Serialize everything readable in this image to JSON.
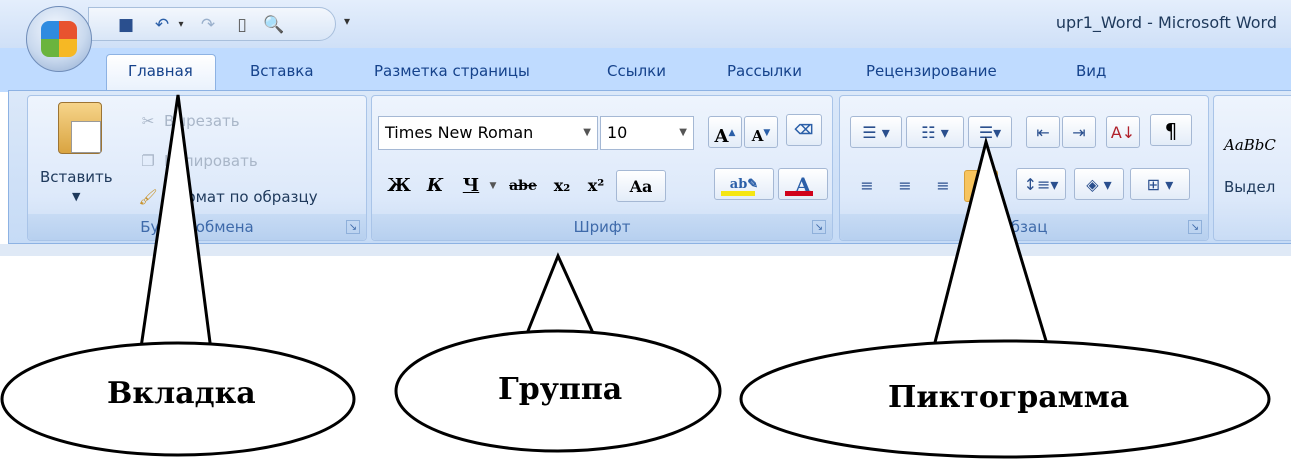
{
  "window": {
    "title": "upr1_Word - Microsoft Word"
  },
  "quick_access": {
    "icons": [
      "save-icon",
      "undo-icon",
      "redo-icon",
      "new-document-icon",
      "print-preview-icon"
    ],
    "customize_glyph": "▾"
  },
  "tabs": [
    {
      "label": "Главная",
      "active": true
    },
    {
      "label": "Вставка"
    },
    {
      "label": "Разметка страницы"
    },
    {
      "label": "Ссылки"
    },
    {
      "label": "Рассылки"
    },
    {
      "label": "Рецензирование"
    },
    {
      "label": "Вид"
    }
  ],
  "ribbon": {
    "clipboard": {
      "caption": "Буфер обмена",
      "paste": "Вставить",
      "cut": "Вырезать",
      "copy": "Копировать",
      "format_painter": "Формат по образцу"
    },
    "font": {
      "caption": "Шрифт",
      "font_name": "Times New Roman",
      "font_size": "10",
      "bold": "Ж",
      "italic": "К",
      "underline": "Ч",
      "strike": "abe",
      "subscript": "x₂",
      "superscript": "x²",
      "change_case": "Aa",
      "highlight_color": "#f5e613",
      "font_color": "#d0021b"
    },
    "paragraph": {
      "caption": "Абзац"
    },
    "styles": {
      "sample": "AaBbC",
      "name": "Выдел"
    }
  },
  "callouts": {
    "tab": "Вкладка",
    "group": "Группа",
    "icon": "Пиктограмма"
  }
}
